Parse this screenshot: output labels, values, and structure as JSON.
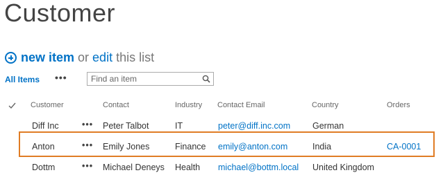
{
  "page": {
    "title": "Customer"
  },
  "new_item": {
    "new_label": "new item",
    "or_label": "or",
    "edit_label": "edit",
    "this_list_label": "this list"
  },
  "view": {
    "all_items_label": "All Items",
    "more_label": "•••",
    "search_placeholder": "Find an item"
  },
  "columns": [
    "Customer",
    "Contact",
    "Industry",
    "Contact Email",
    "Country",
    "Orders"
  ],
  "rows": [
    {
      "customer": "Diff Inc",
      "more": "•••",
      "contact": "Peter Talbot",
      "industry": "IT",
      "email": "peter@diff.inc.com",
      "country": "German",
      "orders": ""
    },
    {
      "customer": "Anton",
      "more": "•••",
      "contact": "Emily Jones",
      "industry": "Finance",
      "email": "emily@anton.com",
      "country": "India",
      "orders": "CA-0001"
    },
    {
      "customer": "Dottm",
      "more": "•••",
      "contact": "Michael Deneys",
      "industry": "Health",
      "email": "michael@bottm.local",
      "country": "United Kingdom",
      "orders": ""
    }
  ],
  "colors": {
    "accent": "#0072c6",
    "highlight": "#e07c24"
  },
  "icons": {
    "add": "plus-circle-icon",
    "search": "search-icon",
    "select_all": "checkmark-icon"
  }
}
